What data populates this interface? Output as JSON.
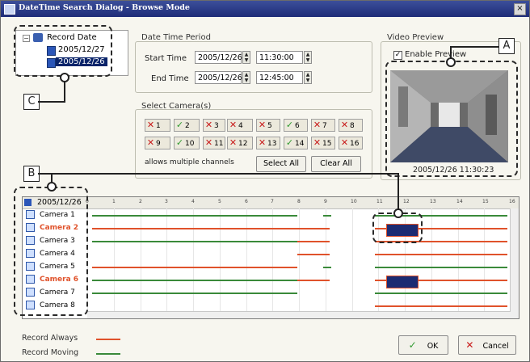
{
  "window": {
    "title": "DateTime Search Dialog - Browse Mode",
    "close_glyph": "×"
  },
  "tree": {
    "root": "Record Date",
    "dates": [
      "2005/12/27",
      "2005/12/26"
    ],
    "selected": "2005/12/26"
  },
  "datetime": {
    "group_label": "Date Time Period",
    "start_label": "Start Time",
    "end_label": "End Time",
    "start_date": "2005/12/26",
    "start_time": "11:30:00",
    "end_date": "2005/12/26",
    "end_time": "12:45:00"
  },
  "cameras_select": {
    "group_label": "Select Camera(s)",
    "channels": [
      {
        "label": "1",
        "checked": false
      },
      {
        "label": "2",
        "checked": true
      },
      {
        "label": "3",
        "checked": false
      },
      {
        "label": "4",
        "checked": false
      },
      {
        "label": "5",
        "checked": false
      },
      {
        "label": "6",
        "checked": true
      },
      {
        "label": "7",
        "checked": false
      },
      {
        "label": "8",
        "checked": false
      },
      {
        "label": "9",
        "checked": false
      },
      {
        "label": "10",
        "checked": true
      },
      {
        "label": "11",
        "checked": false
      },
      {
        "label": "12",
        "checked": false
      },
      {
        "label": "13",
        "checked": false
      },
      {
        "label": "14",
        "checked": true
      },
      {
        "label": "15",
        "checked": false
      },
      {
        "label": "16",
        "checked": false
      }
    ],
    "hint": "allows multiple channels",
    "select_all": "Select All",
    "clear_all": "Clear All"
  },
  "preview": {
    "group_label": "Video Preview",
    "enable_label": "Enable Preview",
    "enabled": true,
    "timestamp": "2005/12/26 11:30:23"
  },
  "callouts": {
    "a": "A",
    "b": "B",
    "c": "C"
  },
  "timeline": {
    "date": "2005/12/26",
    "hour_ticks": [
      "0",
      "1",
      "2",
      "3",
      "4",
      "5",
      "6",
      "7",
      "8",
      "9",
      "10",
      "11",
      "12",
      "13",
      "14",
      "15",
      "16"
    ],
    "cameras": [
      {
        "name": "Camera 1",
        "highlight": false
      },
      {
        "name": "Camera 2",
        "highlight": true
      },
      {
        "name": "Camera 3",
        "highlight": false
      },
      {
        "name": "Camera 4",
        "highlight": false
      },
      {
        "name": "Camera 5",
        "highlight": false
      },
      {
        "name": "Camera 6",
        "highlight": true
      },
      {
        "name": "Camera 7",
        "highlight": false
      },
      {
        "name": "Camera 8",
        "highlight": false
      }
    ]
  },
  "legend": {
    "always_label": "Record Always",
    "moving_label": "Record Moving",
    "always_color": "#e0522b",
    "moving_color": "#3a8a3a"
  },
  "buttons": {
    "ok": "OK",
    "cancel": "Cancel"
  },
  "colors": {
    "accent": "#0a246a",
    "title_bar": "#1e2c78"
  }
}
